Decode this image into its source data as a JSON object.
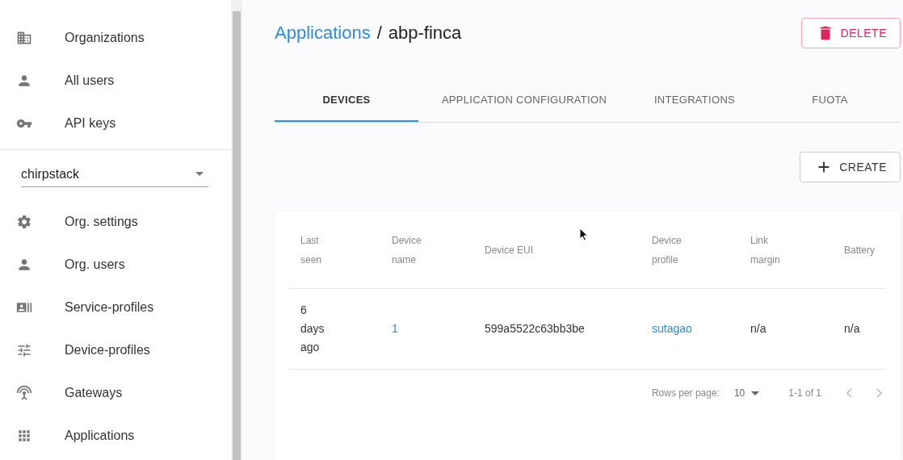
{
  "sidebar": {
    "top_items": [
      {
        "label": "Organizations"
      },
      {
        "label": "All users"
      },
      {
        "label": "API keys"
      }
    ],
    "organization_select": {
      "value": "chirpstack"
    },
    "org_items": [
      {
        "label": "Org. settings"
      },
      {
        "label": "Org. users"
      },
      {
        "label": "Service-profiles"
      },
      {
        "label": "Device-profiles"
      },
      {
        "label": "Gateways"
      },
      {
        "label": "Applications"
      }
    ]
  },
  "breadcrumb": {
    "parent": "Applications",
    "separator": "/",
    "current": "abp-finca"
  },
  "delete_button": "DELETE",
  "tabs": [
    {
      "label": "DEVICES",
      "selected": true
    },
    {
      "label": "APPLICATION CONFIGURATION",
      "selected": false
    },
    {
      "label": "INTEGRATIONS",
      "selected": false
    },
    {
      "label": "FUOTA",
      "selected": false
    }
  ],
  "create_button": "CREATE",
  "table": {
    "columns": [
      "Last seen",
      "Device name",
      "Device EUI",
      "Device profile",
      "Link margin",
      "Battery"
    ],
    "rows": [
      {
        "last_seen": "6 days ago",
        "device_name": "1",
        "device_eui": "599a5522c63bb3be",
        "device_profile": "sutagao",
        "link_margin": "n/a",
        "battery": "n/a"
      }
    ]
  },
  "pagination": {
    "rows_per_page_label": "Rows per page:",
    "rows_per_page": "10",
    "range": "1-1 of 1"
  }
}
